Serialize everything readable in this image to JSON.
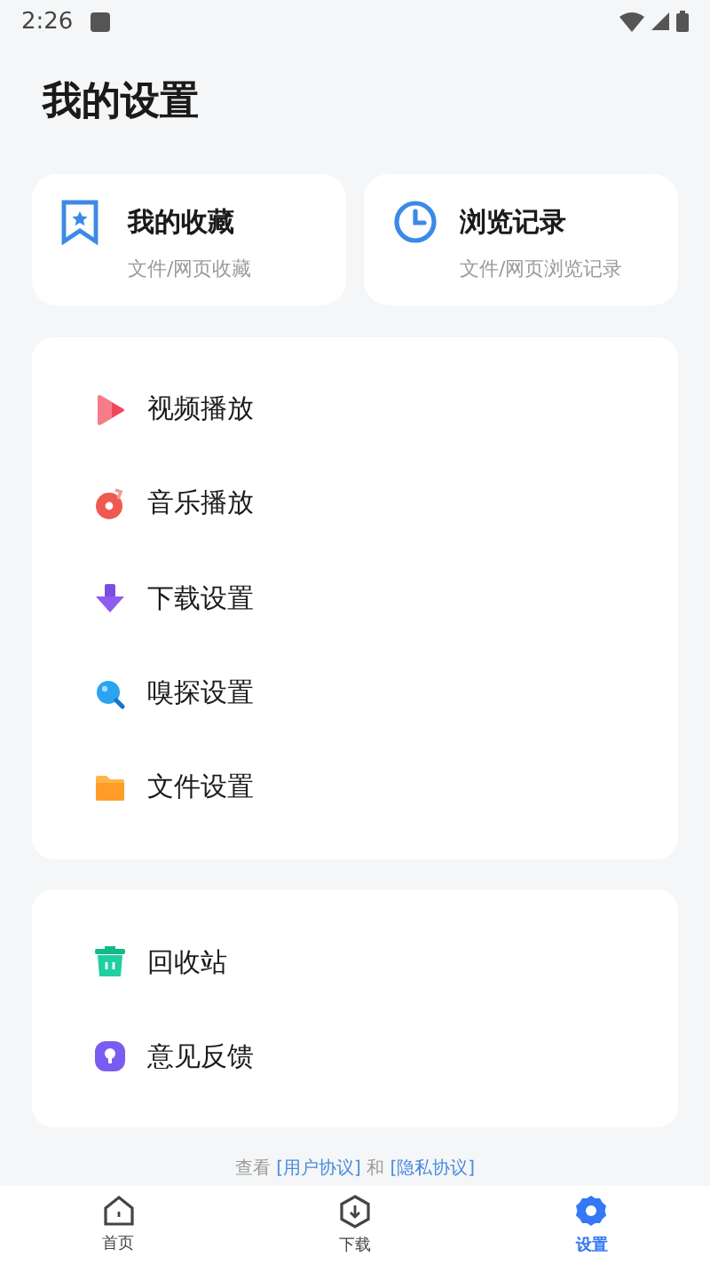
{
  "status_bar": {
    "time": "2:26"
  },
  "title": "我的设置",
  "quick_cards": [
    {
      "kind": "bookmark",
      "title": "我的收藏",
      "subtitle": "文件/网页收藏"
    },
    {
      "kind": "clock",
      "title": "浏览记录",
      "subtitle": "文件/网页浏览记录"
    }
  ],
  "settings_group": [
    {
      "kind": "video",
      "label": "视频播放"
    },
    {
      "kind": "music",
      "label": "音乐播放"
    },
    {
      "kind": "download",
      "label": "下载设置"
    },
    {
      "kind": "sniff",
      "label": "嗅探设置"
    },
    {
      "kind": "folder",
      "label": "文件设置"
    }
  ],
  "other_group": [
    {
      "kind": "trash",
      "label": "回收站"
    },
    {
      "kind": "feedback",
      "label": "意见反馈"
    }
  ],
  "agreement": {
    "prefix": "查看",
    "user_link": "[用户协议]",
    "joiner": "和",
    "privacy_link": "[隐私协议]"
  },
  "bottom_nav": [
    {
      "kind": "home",
      "label": "首页",
      "selected": false
    },
    {
      "kind": "download",
      "label": "下载",
      "selected": false
    },
    {
      "kind": "settings",
      "label": "设置",
      "selected": true
    }
  ]
}
